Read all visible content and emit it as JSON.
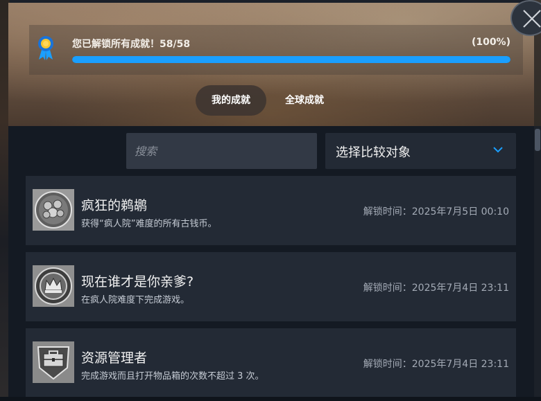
{
  "progress": {
    "title": "您已解锁所有成就！58/58",
    "percent_label": "(100%)",
    "fraction": 1.0
  },
  "tabs": [
    {
      "label": "我的成就",
      "active": true
    },
    {
      "label": "全球成就",
      "active": false
    }
  ],
  "search": {
    "placeholder": "搜索",
    "value": ""
  },
  "compare": {
    "label": "选择比较对象"
  },
  "achievements": [
    {
      "name": "疯狂的鹈鹕",
      "description": "获得“疯人院”难度的所有古钱币。",
      "unlock_time": "解锁时间：2025年7月5日 00:10",
      "icon": "coin-pile-icon"
    },
    {
      "name": "现在谁才是你亲爹?",
      "description": "在疯人院难度下完成游戏。",
      "unlock_time": "解锁时间：2025年7月4日 23:11",
      "icon": "crown-badge-icon"
    },
    {
      "name": "资源管理者",
      "description": "完成游戏而且打开物品箱的次数不超过 3 次。",
      "unlock_time": "解锁时间：2025年7月4日 23:11",
      "icon": "toolbox-shield-icon"
    }
  ],
  "colors": {
    "accent": "#1a9fff",
    "panel": "#141a23",
    "card": "#232a35"
  }
}
